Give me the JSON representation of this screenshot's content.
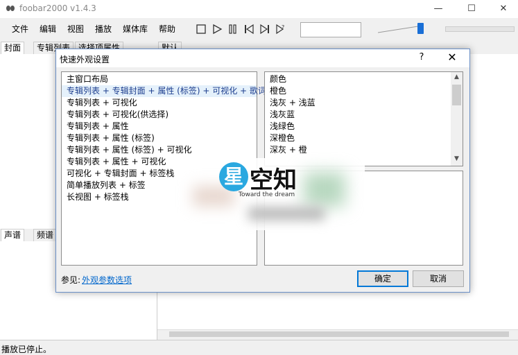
{
  "window": {
    "title": "foobar2000 v1.4.3",
    "minimize": "—",
    "maximize": "☐",
    "close": "✕"
  },
  "menu": [
    "文件",
    "编辑",
    "视图",
    "播放",
    "媒体库",
    "帮助"
  ],
  "toolbar": {
    "stop": "stop-icon",
    "play": "play-icon",
    "pause": "pause-icon",
    "previous": "previous-icon",
    "next": "next-icon",
    "random": "random-icon",
    "volume_level": 0.95
  },
  "panels": {
    "tabs_top": [
      "封面",
      "专辑列表",
      "选择项属性"
    ],
    "tab_default": "默认",
    "tabs_bottom": [
      "声谱",
      "频谱"
    ]
  },
  "status": "播放已停止。",
  "dialog": {
    "title": "快速外观设置",
    "help": "?",
    "close": "✕",
    "layout_header": "主窗口布局",
    "layouts": [
      "专辑列表 + 专辑封面 + 属性 (标签) + 可视化 + 歌词",
      "专辑列表 + 可视化",
      "专辑列表 + 可视化(供选择)",
      "专辑列表 + 属性",
      "专辑列表 + 属性 (标签)",
      "专辑列表 + 属性 (标签) + 可视化",
      "专辑列表 + 属性 + 可视化",
      "可视化 + 专辑封面 + 标签栈",
      "简单播放列表 + 标签",
      "长视图 + 标签栈"
    ],
    "selected_layout_index": 0,
    "color_header": "颜色",
    "colors": [
      "橙色",
      "浅灰 + 浅蓝",
      "浅灰蓝",
      "浅绿色",
      "深橙色",
      "深灰 + 橙"
    ],
    "see_label": "参见:",
    "see_link": "外观参数选项",
    "ok": "确定",
    "cancel": "取消"
  },
  "watermark": {
    "logo_char": "星",
    "text": "空知",
    "subtitle": "Toward the dream"
  },
  "colors": {
    "accent": "#0078d7",
    "selection_bg": "#e5f1fb",
    "link": "#0066cc",
    "volume_thumb": "#1a6fd6",
    "logo": "#2aa8e0"
  }
}
